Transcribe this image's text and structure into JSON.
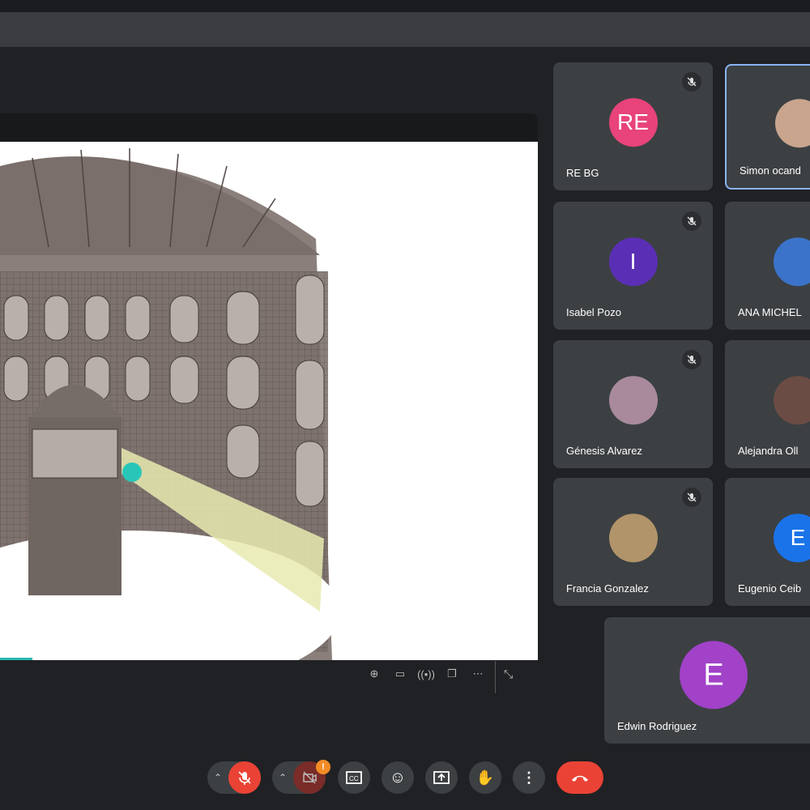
{
  "participants": [
    {
      "name": "RE BG",
      "initials": "RE",
      "color": "#e8437a",
      "muted": true
    },
    {
      "name": "Simon ocand",
      "initials": "",
      "photo": true,
      "muted": false,
      "active": true
    },
    {
      "name": "Isabel Pozo",
      "initials": "I",
      "color": "#5b2fb5",
      "muted": true
    },
    {
      "name": "ANA MICHEL",
      "initials": "",
      "photo": true,
      "muted": false
    },
    {
      "name": "Génesis Alvarez",
      "initials": "",
      "photo": true,
      "muted": true
    },
    {
      "name": "Alejandra Oll",
      "initials": "",
      "photo": true,
      "muted": false
    },
    {
      "name": "Francia Gonzalez",
      "initials": "",
      "photo": true,
      "muted": true
    },
    {
      "name": "Eugenio Ceib",
      "initials": "E",
      "color": "#1a73e8",
      "muted": false
    },
    {
      "name": "Edwin Rodriguez",
      "initials": "E",
      "color": "#a142c8",
      "muted": false
    }
  ],
  "presentation": {
    "progress_percent": 6
  },
  "controls": {
    "camera_warning_badge": "!"
  },
  "colors": {
    "end_call": "#ea4335",
    "accent": "#8ab4f8"
  }
}
